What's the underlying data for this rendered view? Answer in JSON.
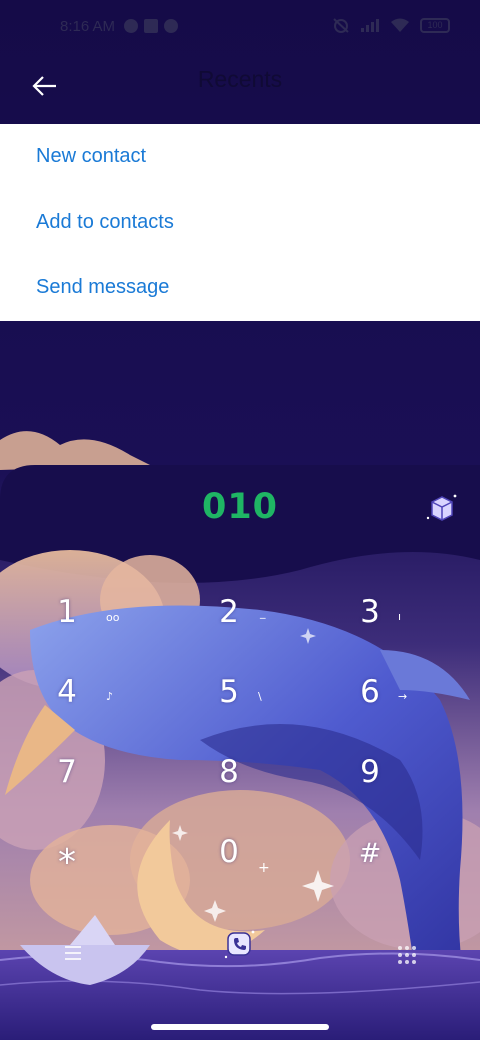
{
  "status_bar": {
    "time": "8:16 AM",
    "battery": "100",
    "left_icons": [
      "notification-icon",
      "square-notification-icon",
      "notification-icon"
    ],
    "right_icons": [
      "alarm-off-icon",
      "cellular-signal-icon",
      "wifi-icon",
      "battery-icon"
    ]
  },
  "app_bar": {
    "title": "Recents",
    "back_icon": "back-arrow-icon"
  },
  "menu": {
    "items": [
      {
        "label": "New contact"
      },
      {
        "label": "Add to contacts"
      },
      {
        "label": "Send message"
      }
    ]
  },
  "dialer": {
    "number": "010",
    "theme_icon": "theme-cube-icon",
    "keys": [
      {
        "digit": "1",
        "sub": "oo"
      },
      {
        "digit": "2",
        "sub": "_"
      },
      {
        "digit": "3",
        "sub": "ı"
      },
      {
        "digit": "4",
        "sub": "♪"
      },
      {
        "digit": "5",
        "sub": "\\"
      },
      {
        "digit": "6",
        "sub": "→"
      },
      {
        "digit": "7",
        "sub": ""
      },
      {
        "digit": "8",
        "sub": ""
      },
      {
        "digit": "9",
        "sub": ""
      },
      {
        "digit": "*",
        "sub": ""
      },
      {
        "digit": "0",
        "sub": "+"
      },
      {
        "digit": "#",
        "sub": ""
      }
    ]
  },
  "bottom_bar": {
    "left_icon": "menu-lines-icon",
    "center_icon": "call-icon",
    "right_icon": "dialpad-grid-icon"
  },
  "colors": {
    "background": "#130b45",
    "menu_text": "#1a7ad6",
    "number": "#1fb564",
    "key_text": "#ffffff"
  }
}
